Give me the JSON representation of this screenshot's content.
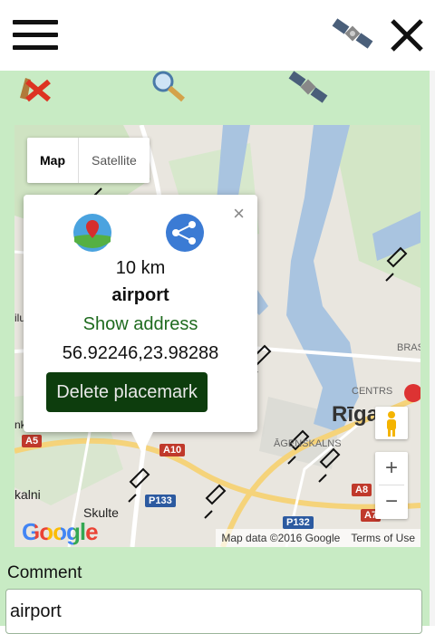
{
  "topbar": {
    "menu_icon": "hamburger-menu-icon",
    "satellite_icon": "satellite-icon",
    "close_icon": "close-icon"
  },
  "toolbar": {
    "icons": [
      "delete-placemark-icon",
      "search-icon",
      "satellite-icon"
    ]
  },
  "map": {
    "type_control": {
      "map_label": "Map",
      "satellite_label": "Satellite",
      "selected": "Map"
    },
    "popup": {
      "distance": "10 km",
      "name": "airport",
      "show_address": "Show address",
      "coordinates": "56.92246,23.98288",
      "delete_button": "Delete placemark",
      "close": "×"
    },
    "labels": {
      "city": "Rīga",
      "centrs": "CENTRS",
      "agenskalns": "ĀGENSKALNS",
      "bras": "BRAS",
      "skulte": "Skulte",
      "kalni": "kalni",
      "ilu": "ilu",
      "nk": "nk"
    },
    "road_badges": [
      "A5",
      "A10",
      "P133",
      "A8",
      "P132",
      "A7"
    ],
    "zoom": {
      "in": "+",
      "out": "−"
    },
    "google_logo": "Google",
    "attribution": "Map data ©2016 Google",
    "terms": "Terms of Use"
  },
  "comment": {
    "label": "Comment",
    "value": "airport"
  },
  "colors": {
    "panel_bg": "#c8ebc4",
    "delete_button_bg": "#0d3d0d",
    "link_green": "#1f6b1f",
    "river": "#a9c4e0"
  }
}
